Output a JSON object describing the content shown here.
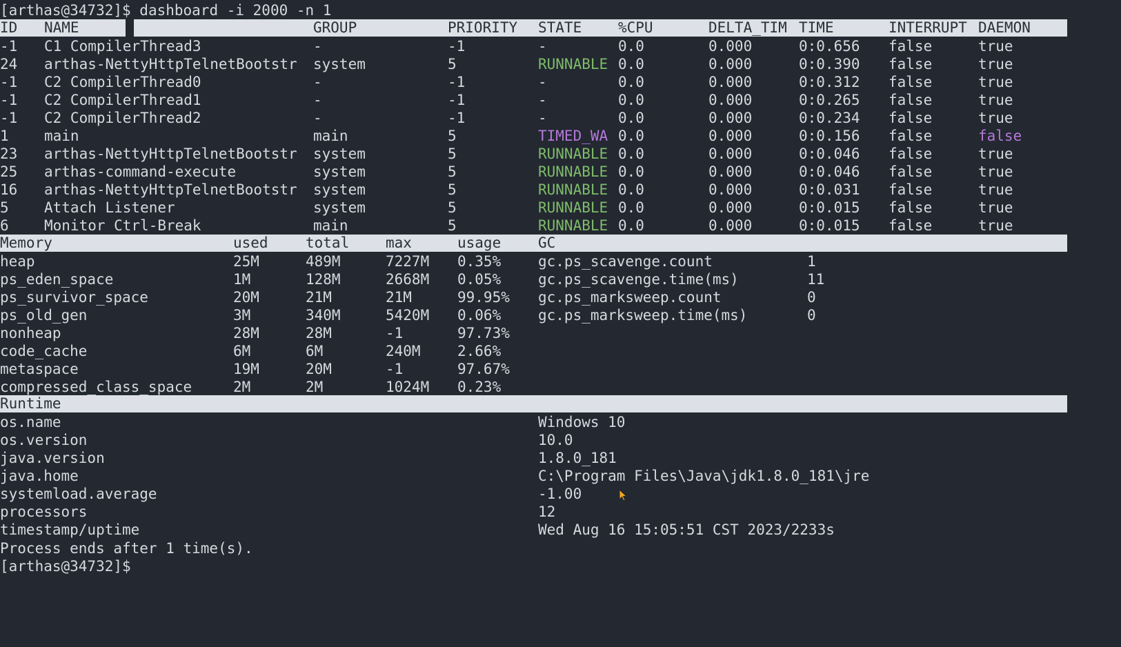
{
  "prompt": "[arthas@34732]$",
  "command": " dashboard -i 2000 -n 1",
  "threads": {
    "headers": [
      "ID",
      "NAME",
      "GROUP",
      "PRIORITY",
      "STATE",
      "%CPU",
      "DELTA_TIM",
      "TIME",
      "INTERRUPT",
      "DAEMON"
    ],
    "rows": [
      [
        "-1",
        "C1 CompilerThread3",
        "-",
        "-1",
        "-",
        "0.0",
        "0.000",
        "0:0.656",
        "false",
        "true"
      ],
      [
        "24",
        "arthas-NettyHttpTelnetBootstr",
        "system",
        "5",
        "RUNNABLE",
        "0.0",
        "0.000",
        "0:0.390",
        "false",
        "true"
      ],
      [
        "-1",
        "C2 CompilerThread0",
        "-",
        "-1",
        "-",
        "0.0",
        "0.000",
        "0:0.312",
        "false",
        "true"
      ],
      [
        "-1",
        "C2 CompilerThread1",
        "-",
        "-1",
        "-",
        "0.0",
        "0.000",
        "0:0.265",
        "false",
        "true"
      ],
      [
        "-1",
        "C2 CompilerThread2",
        "-",
        "-1",
        "-",
        "0.0",
        "0.000",
        "0:0.234",
        "false",
        "true"
      ],
      [
        "1",
        "main",
        "main",
        "5",
        "TIMED_WA",
        "0.0",
        "0.000",
        "0:0.156",
        "false",
        "false"
      ],
      [
        "23",
        "arthas-NettyHttpTelnetBootstr",
        "system",
        "5",
        "RUNNABLE",
        "0.0",
        "0.000",
        "0:0.046",
        "false",
        "true"
      ],
      [
        "25",
        "arthas-command-execute",
        "system",
        "5",
        "RUNNABLE",
        "0.0",
        "0.000",
        "0:0.046",
        "false",
        "true"
      ],
      [
        "16",
        "arthas-NettyHttpTelnetBootstr",
        "system",
        "5",
        "RUNNABLE",
        "0.0",
        "0.000",
        "0:0.031",
        "false",
        "true"
      ],
      [
        "5",
        "Attach Listener",
        "system",
        "5",
        "RUNNABLE",
        "0.0",
        "0.000",
        "0:0.015",
        "false",
        "true"
      ],
      [
        "6",
        "Monitor Ctrl-Break",
        "main",
        "5",
        "RUNNABLE",
        "0.0",
        "0.000",
        "0:0.015",
        "false",
        "true"
      ]
    ]
  },
  "memory": {
    "headers": [
      "Memory",
      "used",
      "total",
      "max",
      "usage",
      "GC"
    ],
    "rows": [
      [
        "heap",
        "25M",
        "489M",
        "7227M",
        "0.35%"
      ],
      [
        "ps_eden_space",
        "1M",
        "128M",
        "2668M",
        "0.05%"
      ],
      [
        "ps_survivor_space",
        "20M",
        "21M",
        "21M",
        "99.95%"
      ],
      [
        "ps_old_gen",
        "3M",
        "340M",
        "5420M",
        "0.06%"
      ],
      [
        "nonheap",
        "28M",
        "28M",
        "-1",
        "97.73%"
      ],
      [
        "code_cache",
        "6M",
        "6M",
        "240M",
        "2.66%"
      ],
      [
        "metaspace",
        "19M",
        "20M",
        "-1",
        "97.67%"
      ],
      [
        "compressed_class_space",
        "2M",
        "2M",
        "1024M",
        "0.23%"
      ]
    ],
    "gc": [
      [
        "gc.ps_scavenge.count",
        "1"
      ],
      [
        "gc.ps_scavenge.time(ms)",
        "11"
      ],
      [
        "gc.ps_marksweep.count",
        "0"
      ],
      [
        "gc.ps_marksweep.time(ms)",
        "0"
      ]
    ]
  },
  "runtime": {
    "header": "Runtime",
    "rows": [
      [
        "os.name",
        "Windows 10"
      ],
      [
        "os.version",
        "10.0"
      ],
      [
        "java.version",
        "1.8.0_181"
      ],
      [
        "java.home",
        "C:\\Program Files\\Java\\jdk1.8.0_181\\jre"
      ],
      [
        "systemload.average",
        "-1.00"
      ],
      [
        "processors",
        "12"
      ],
      [
        "timestamp/uptime",
        "Wed Aug 16 15:05:51 CST 2023/2233s"
      ]
    ]
  },
  "footer": "Process ends after 1 time(s).",
  "final_prompt": "[arthas@34732]$",
  "colors": {
    "background": "#232831",
    "foreground": "#d6d9de",
    "header_bar": "#dde1e7",
    "runnable": "#7fbb6a",
    "timed_waiting": "#b479d9",
    "daemon_false": "#b479d9",
    "cursor": "#f5a623"
  },
  "icons": {
    "mouse_cursor": "mouse-pointer-icon"
  }
}
